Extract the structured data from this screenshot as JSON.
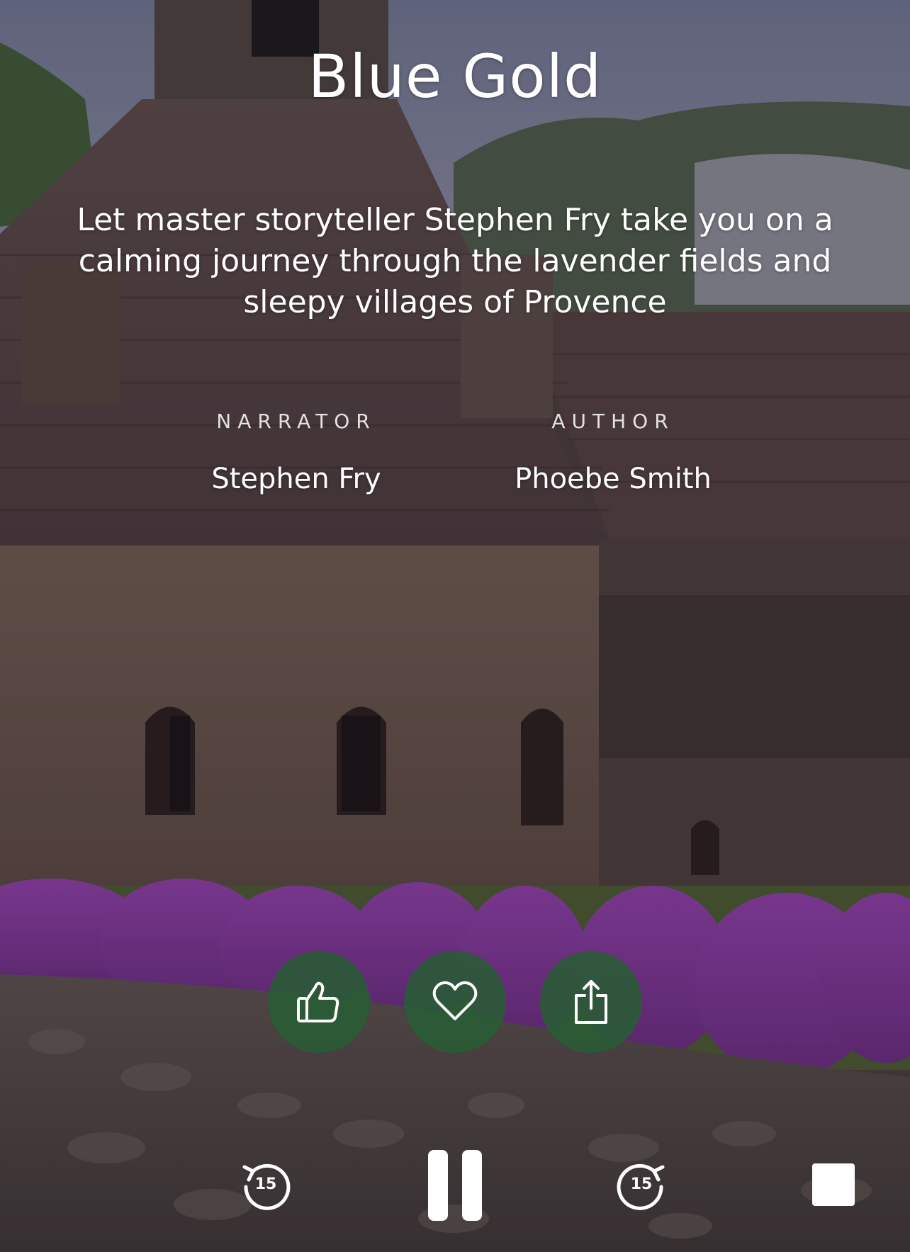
{
  "story": {
    "title": "Blue Gold",
    "description": "Let master storyteller Stephen Fry take you on a calming journey through the lavender fields and sleepy villages of Provence",
    "narrator_label": "NARRATOR",
    "narrator": "Stephen Fry",
    "author_label": "AUTHOR",
    "author": "Phoebe Smith"
  },
  "actions": {
    "like_icon": "thumbs-up-icon",
    "favorite_icon": "heart-icon",
    "share_icon": "share-icon",
    "button_color": "#2d6a3a"
  },
  "controls": {
    "rewind_seconds": "15",
    "forward_seconds": "15",
    "rewind_icon": "rewind-15-icon",
    "pause_icon": "pause-icon",
    "forward_icon": "forward-15-icon",
    "stop_icon": "stop-icon"
  },
  "background": {
    "accent_lavender": "#8a3fa0",
    "stone": "#6b5a52"
  }
}
